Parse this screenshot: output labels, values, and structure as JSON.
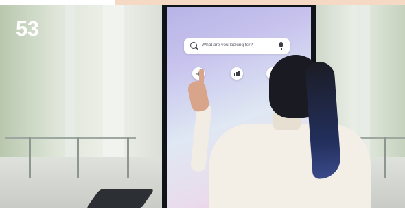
{
  "scene": {
    "badge_number": "53",
    "kiosk_screen": {
      "search_placeholder": "What are you looking for?",
      "icons": [
        "search-icon",
        "mic-icon",
        "plus-icon",
        "chart-icon"
      ]
    }
  },
  "colors": {
    "accent_strip": "#f6d9c4",
    "kiosk_frame": "#101318",
    "screen_top": "#b7b3e6",
    "screen_bottom": "#f0c9e0"
  }
}
